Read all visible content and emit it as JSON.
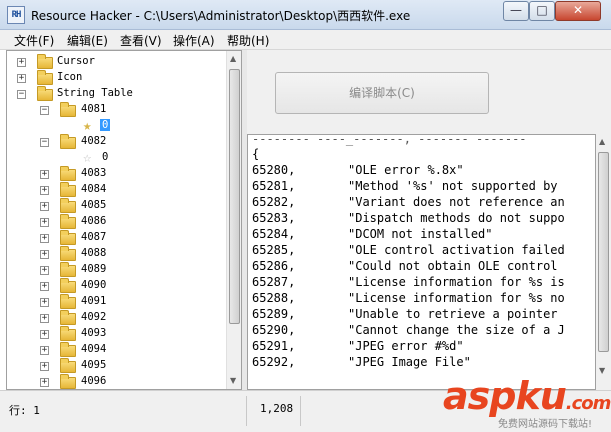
{
  "window": {
    "title": "Resource Hacker - C:\\Users\\Administrator\\Desktop\\西西软件.exe",
    "app_icon_text": "RH",
    "controls": {
      "minimize": "—",
      "maximize": "□",
      "close": "✕"
    }
  },
  "menu": [
    "文件(F)",
    "编辑(E)",
    "查看(V)",
    "操作(A)",
    "帮助(H)"
  ],
  "tree": {
    "cursor": "Cursor",
    "icon": "Icon",
    "string_table": "String Table",
    "n4081": "4081",
    "n4081_child": "0",
    "n4082": "4082",
    "n4082_child": "0",
    "groups": [
      "4083",
      "4084",
      "4085",
      "4086",
      "4087",
      "4088",
      "4089",
      "4090",
      "4091",
      "4092",
      "4093",
      "4094",
      "4095",
      "4096"
    ]
  },
  "right_pane": {
    "compile_button": "编译脚本(C)"
  },
  "editor": {
    "partial_top": "-------- ----_-------, ------- -------",
    "open_brace": "{",
    "lines": [
      {
        "id": "65280,",
        "text": "\"OLE error %.8x\""
      },
      {
        "id": "65281,",
        "text": "\"Method '%s' not supported by"
      },
      {
        "id": "65282,",
        "text": "\"Variant does not reference an"
      },
      {
        "id": "65283,",
        "text": "\"Dispatch methods do not suppo"
      },
      {
        "id": "65284,",
        "text": "\"DCOM not installed\""
      },
      {
        "id": "65285,",
        "text": "\"OLE control activation failed"
      },
      {
        "id": "65286,",
        "text": "\"Could not obtain OLE control"
      },
      {
        "id": "65287,",
        "text": "\"License information for %s is"
      },
      {
        "id": "65288,",
        "text": "\"License information for %s no"
      },
      {
        "id": "65289,",
        "text": "\"Unable to retrieve a pointer"
      },
      {
        "id": "65290,",
        "text": "\"Cannot change the size of a J"
      },
      {
        "id": "65291,",
        "text": "\"JPEG error #%d\""
      },
      {
        "id": "65292,",
        "text": "\"JPEG Image File\""
      }
    ]
  },
  "status": {
    "line": "行: 1",
    "position": "1,208"
  },
  "watermark": {
    "main": "aspku",
    "tld": ".com",
    "sub": "免费网站源码下载站!"
  },
  "colors": {
    "selection": "#3399ff",
    "folder": "#f0c94c",
    "watermark": "#e8451f"
  }
}
